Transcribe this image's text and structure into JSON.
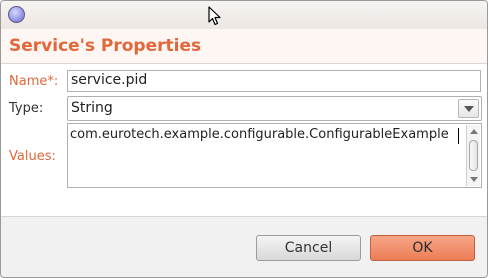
{
  "window": {
    "close_icon": "close-circle-icon",
    "cursor_icon": "mouse-pointer-icon"
  },
  "header": {
    "title": "Service's Properties",
    "title_color": "#e0683a"
  },
  "form": {
    "name_label": "Name*:",
    "name_value": "service.pid",
    "type_label": "Type:",
    "type_value": "String",
    "values_label": "Values:",
    "values_value": "com.eurotech.example.configurable.ConfigurableExample"
  },
  "buttons": {
    "cancel_label": "Cancel",
    "ok_label": "OK",
    "ok_color": "#ec7e56"
  }
}
